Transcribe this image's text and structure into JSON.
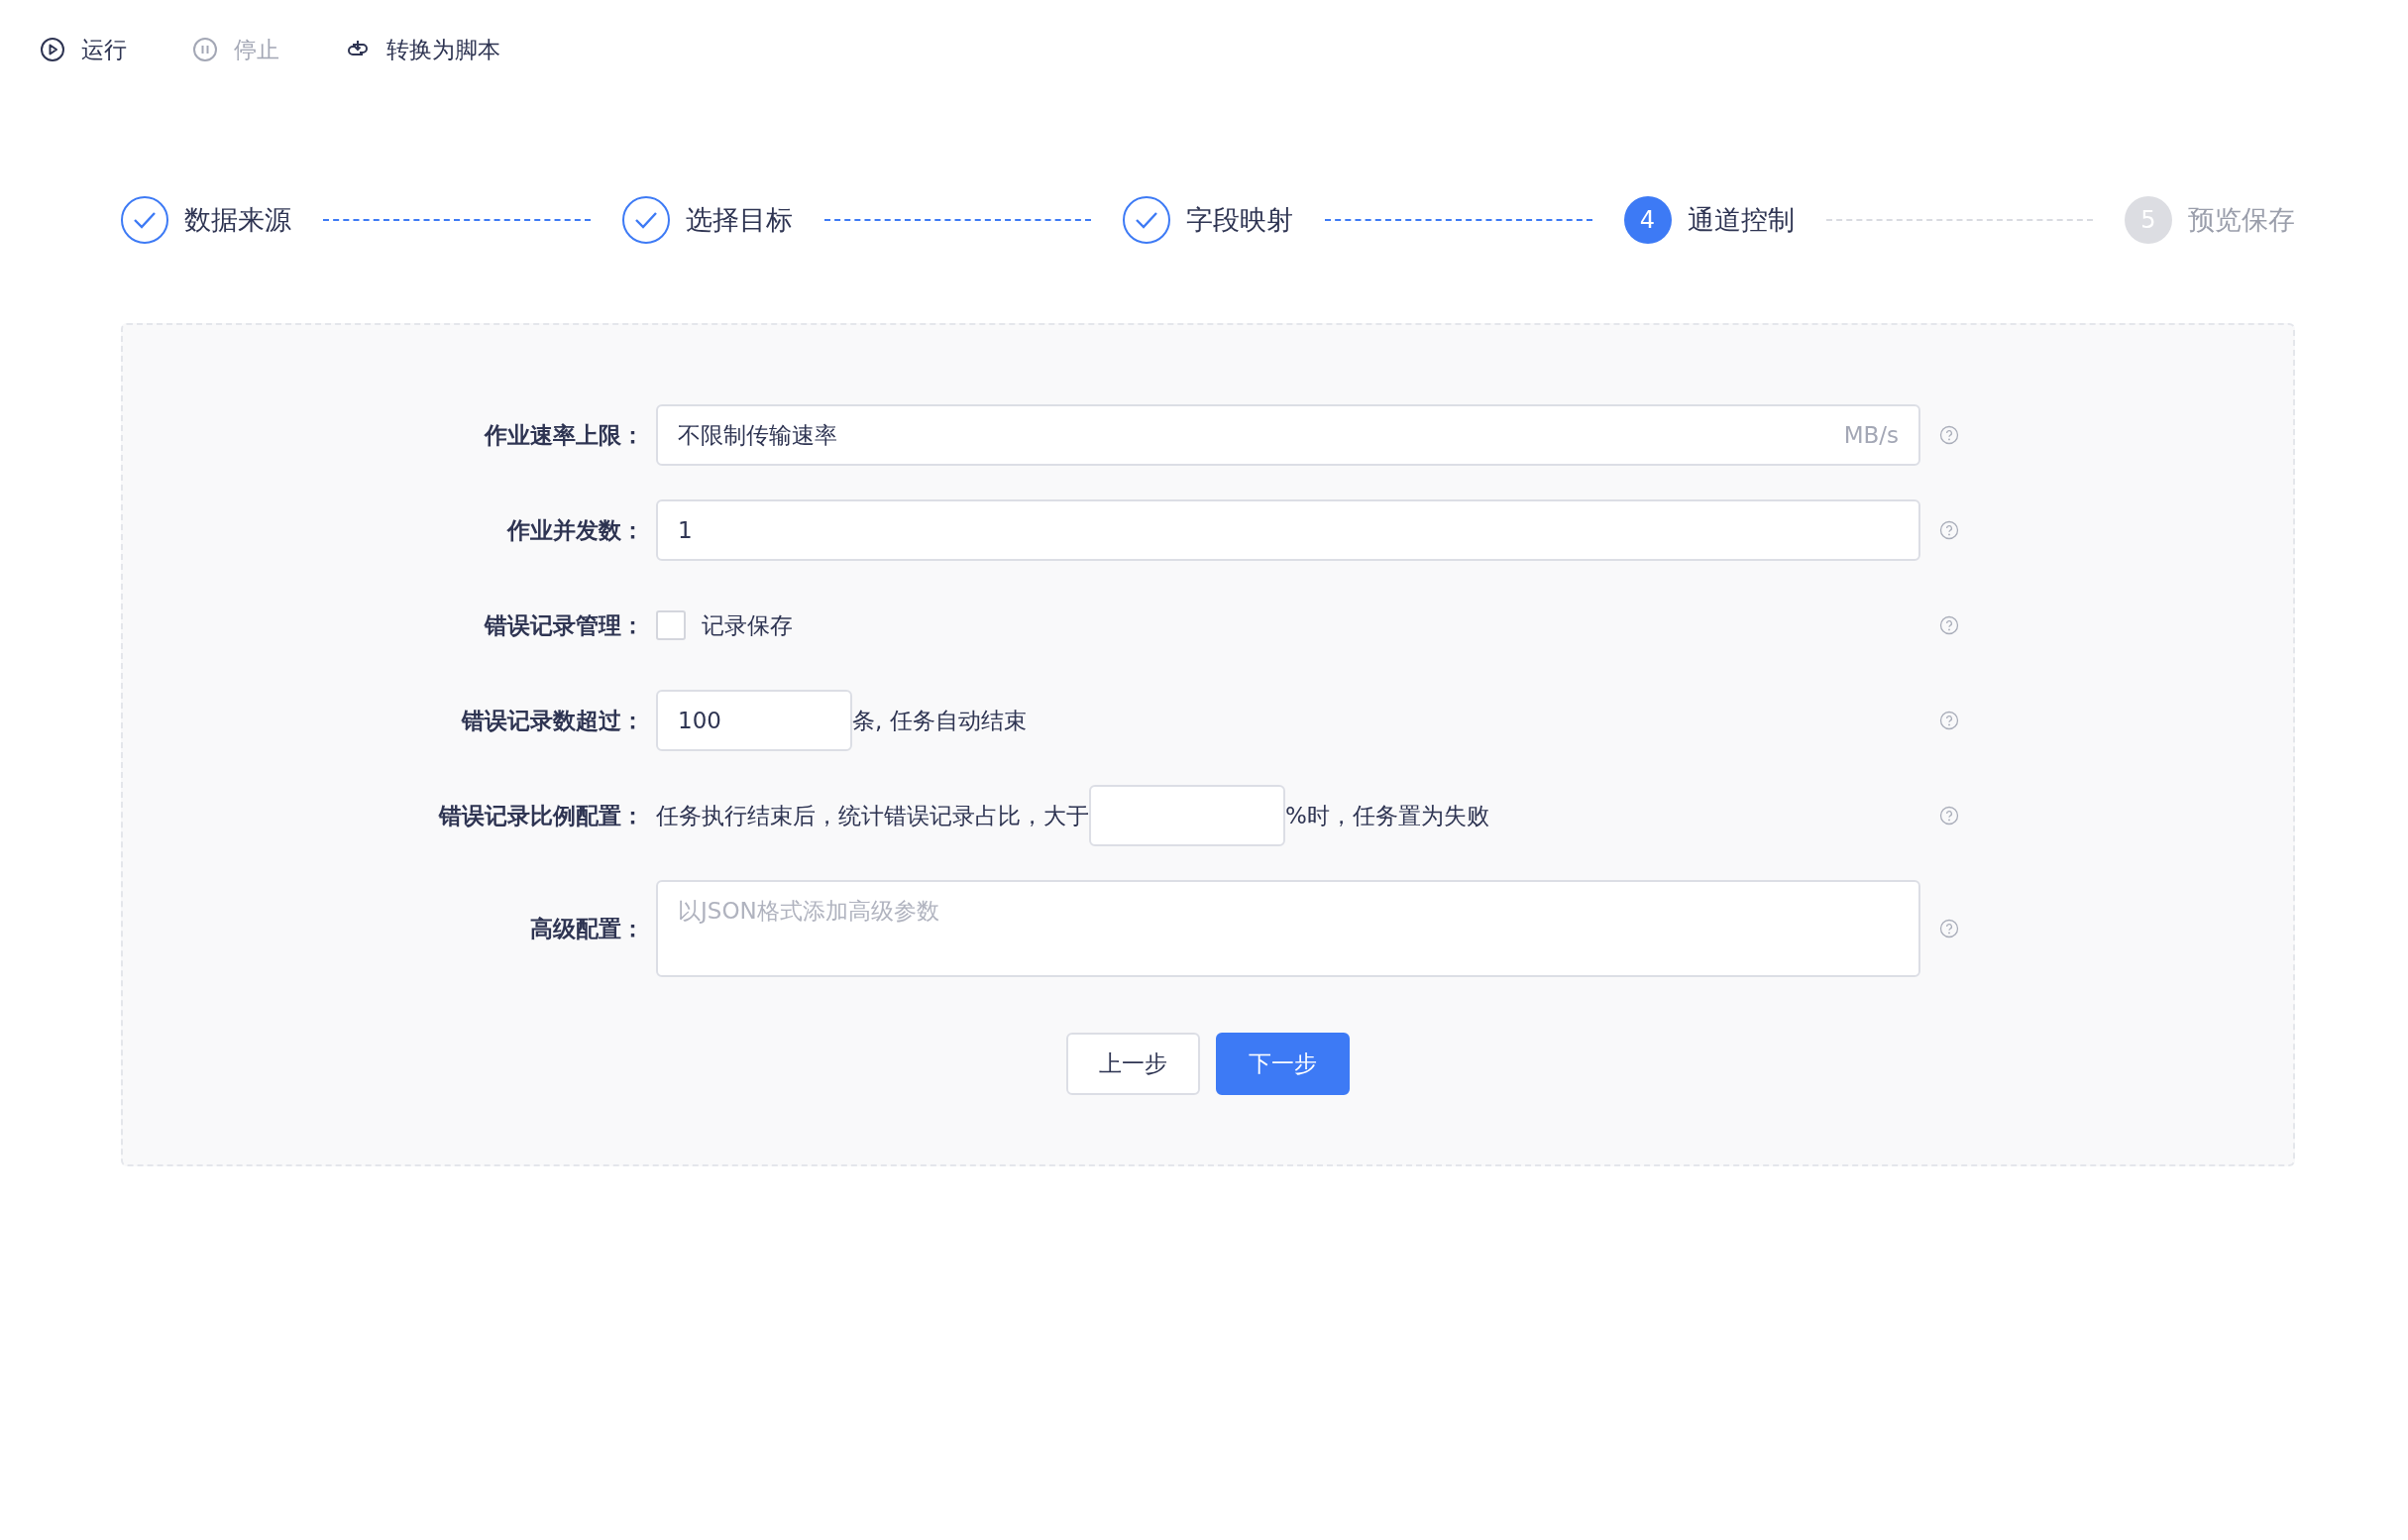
{
  "toolbar": [
    {
      "kind": "play",
      "label": "运行",
      "disabled": false
    },
    {
      "kind": "pause",
      "label": "停止",
      "disabled": true
    },
    {
      "kind": "convert",
      "label": "转换为脚本",
      "disabled": false
    }
  ],
  "steps": [
    {
      "title": "数据来源",
      "kind": "done"
    },
    {
      "title": "选择目标",
      "kind": "done"
    },
    {
      "title": "字段映射",
      "kind": "done"
    },
    {
      "number": "4",
      "title": "通道控制",
      "kind": "active"
    },
    {
      "number": "5",
      "title": "预览保存",
      "kind": "waiting"
    }
  ],
  "form": {
    "rows": [
      {
        "label": "作业速率上限：",
        "controls": [
          {
            "kind": "input",
            "value": "不限制传输速率",
            "suffix": "MB/s"
          }
        ]
      },
      {
        "label": "作业并发数：",
        "controls": [
          {
            "kind": "input",
            "value": "1"
          }
        ]
      },
      {
        "label": "错误记录管理：",
        "controls": [
          {
            "kind": "checkbox",
            "checked": false,
            "text": "记录保存"
          }
        ]
      },
      {
        "label": "错误记录数超过：",
        "controls": [
          {
            "kind": "short_input",
            "value": "100"
          },
          {
            "kind": "text",
            "text": "条, 任务自动结束"
          }
        ]
      },
      {
        "label": "错误记录比例配置：",
        "controls": [
          {
            "kind": "text",
            "text": "任务执行结束后，统计错误记录占比，大于"
          },
          {
            "kind": "short_input"
          },
          {
            "kind": "text",
            "text": "%时，任务置为失败"
          }
        ]
      },
      {
        "label": "高级配置：",
        "controls": [
          {
            "kind": "textarea",
            "placeholder": "以JSON格式添加高级参数"
          }
        ]
      }
    ],
    "buttons": [
      {
        "label": "上一步",
        "primary": false
      },
      {
        "label": "下一步",
        "primary": true
      }
    ]
  }
}
